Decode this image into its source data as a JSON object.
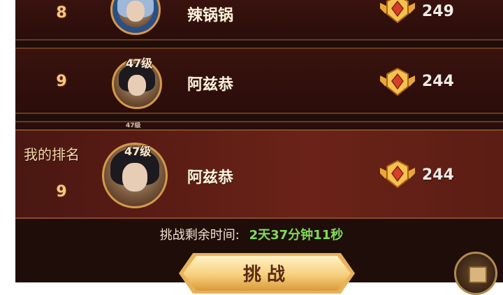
{
  "ranking": {
    "rows": [
      {
        "rank": "8",
        "name": "辣锅锅",
        "score": "249",
        "level": ""
      },
      {
        "rank": "9",
        "name": "阿兹恭",
        "score": "244",
        "level": "47级"
      }
    ],
    "sliver_level": "47级"
  },
  "my_rank": {
    "label": "我的排名",
    "rank": "9",
    "name": "阿兹恭",
    "score": "244",
    "level": "47级"
  },
  "challenge": {
    "timer_label": "挑战剩余时间:",
    "timer_value": "2天37分钟11秒",
    "button_label": "挑战"
  },
  "icons": {
    "medal": "gold-rank-medal-icon",
    "chest": "treasure-chest-icon"
  },
  "colors": {
    "timer_value": "#7fdc58",
    "rank_number": "#f3c987"
  }
}
